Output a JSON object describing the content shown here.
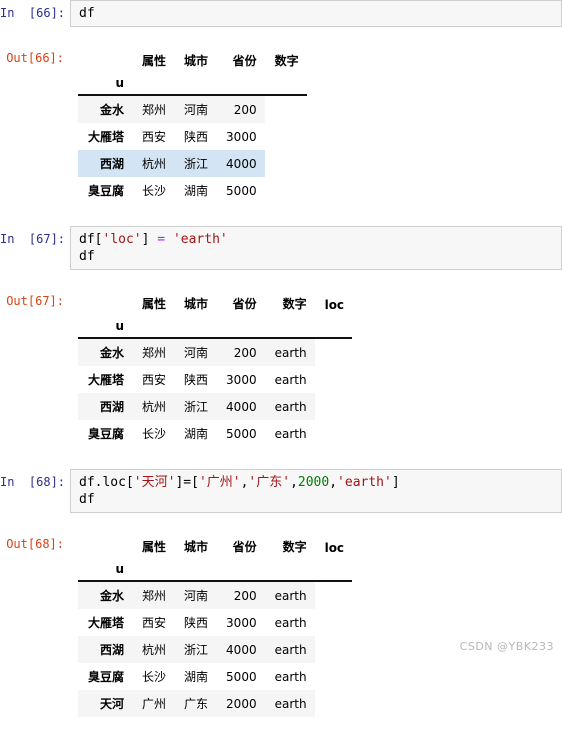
{
  "watermark": "CSDN @YBK233",
  "cells": [
    {
      "in_prompt": "In  [66]:",
      "out_prompt": "Out[66]:",
      "code_lines": [
        [
          {
            "t": "df",
            "c": "plain"
          }
        ]
      ],
      "table": {
        "columns": [
          "属性",
          "城市",
          "省份",
          "数字"
        ],
        "index_name": "u",
        "rows": [
          {
            "index": "金水",
            "values": [
              "郑州",
              "河南",
              "200"
            ],
            "style": "odd"
          },
          {
            "index": "大雁塔",
            "values": [
              "西安",
              "陕西",
              "3000"
            ],
            "style": "even"
          },
          {
            "index": "西湖",
            "values": [
              "杭州",
              "浙江",
              "4000"
            ],
            "style": "selected"
          },
          {
            "index": "臭豆腐",
            "values": [
              "长沙",
              "湖南",
              "5000"
            ],
            "style": "even"
          }
        ]
      }
    },
    {
      "in_prompt": "In  [67]:",
      "out_prompt": "Out[67]:",
      "code_lines": [
        [
          {
            "t": "df[",
            "c": "plain"
          },
          {
            "t": "'loc'",
            "c": "str"
          },
          {
            "t": "] ",
            "c": "plain"
          },
          {
            "t": "=",
            "c": "op"
          },
          {
            "t": " ",
            "c": "plain"
          },
          {
            "t": "'earth'",
            "c": "str"
          }
        ],
        [
          {
            "t": "df",
            "c": "plain"
          }
        ]
      ],
      "table": {
        "columns": [
          "属性",
          "城市",
          "省份",
          "数字",
          "loc"
        ],
        "index_name": "u",
        "rows": [
          {
            "index": "金水",
            "values": [
              "郑州",
              "河南",
              "200",
              "earth"
            ],
            "style": "odd"
          },
          {
            "index": "大雁塔",
            "values": [
              "西安",
              "陕西",
              "3000",
              "earth"
            ],
            "style": "even"
          },
          {
            "index": "西湖",
            "values": [
              "杭州",
              "浙江",
              "4000",
              "earth"
            ],
            "style": "odd"
          },
          {
            "index": "臭豆腐",
            "values": [
              "长沙",
              "湖南",
              "5000",
              "earth"
            ],
            "style": "even"
          }
        ]
      }
    },
    {
      "in_prompt": "In  [68]:",
      "out_prompt": "Out[68]:",
      "code_lines": [
        [
          {
            "t": "df.loc[",
            "c": "plain"
          },
          {
            "t": "'天河'",
            "c": "str"
          },
          {
            "t": "]=[",
            "c": "plain"
          },
          {
            "t": "'广州'",
            "c": "str"
          },
          {
            "t": ",",
            "c": "plain"
          },
          {
            "t": "'广东'",
            "c": "str"
          },
          {
            "t": ",",
            "c": "plain"
          },
          {
            "t": "2000",
            "c": "num"
          },
          {
            "t": ",",
            "c": "plain"
          },
          {
            "t": "'earth'",
            "c": "str"
          },
          {
            "t": "]",
            "c": "plain"
          }
        ],
        [
          {
            "t": "df",
            "c": "plain"
          }
        ]
      ],
      "table": {
        "columns": [
          "属性",
          "城市",
          "省份",
          "数字",
          "loc"
        ],
        "index_name": "u",
        "rows": [
          {
            "index": "金水",
            "values": [
              "郑州",
              "河南",
              "200",
              "earth"
            ],
            "style": "odd"
          },
          {
            "index": "大雁塔",
            "values": [
              "西安",
              "陕西",
              "3000",
              "earth"
            ],
            "style": "even"
          },
          {
            "index": "西湖",
            "values": [
              "杭州",
              "浙江",
              "4000",
              "earth"
            ],
            "style": "odd"
          },
          {
            "index": "臭豆腐",
            "values": [
              "长沙",
              "湖南",
              "5000",
              "earth"
            ],
            "style": "even"
          },
          {
            "index": "天河",
            "values": [
              "广州",
              "广东",
              "2000",
              "earth"
            ],
            "style": "odd"
          }
        ]
      }
    }
  ]
}
